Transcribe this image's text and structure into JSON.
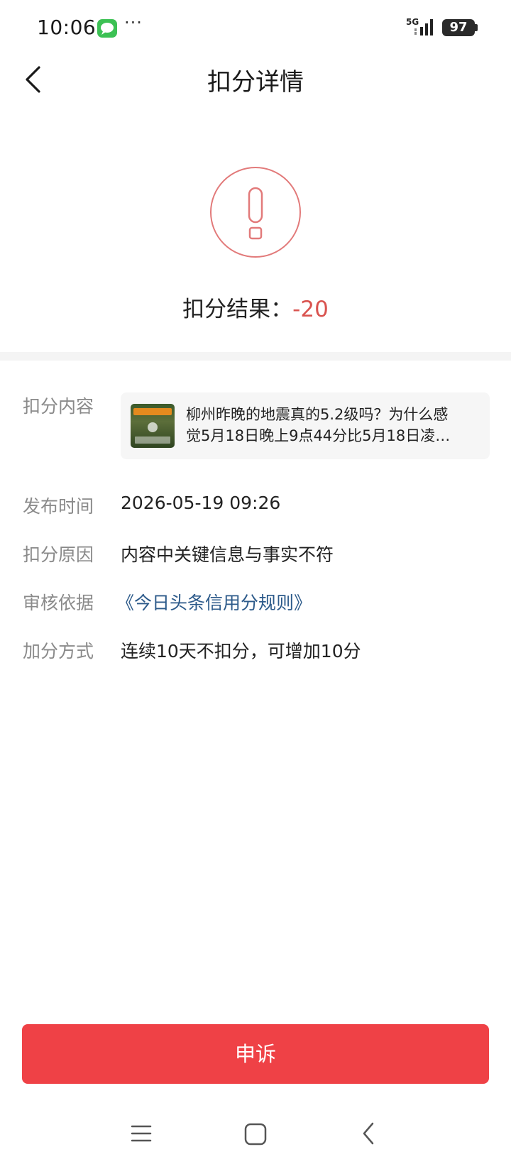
{
  "status_bar": {
    "time": "10:06",
    "network": "5G",
    "battery": "97",
    "more": "···",
    "icons": [
      "message-icon",
      "signal-icon",
      "battery-icon"
    ]
  },
  "nav": {
    "title": "扣分详情",
    "back_icon": "chevron-left-icon"
  },
  "result": {
    "icon": "exclamation-circle-icon",
    "label": "扣分结果：",
    "value": "-20",
    "value_color": "#d9534f"
  },
  "details": {
    "content_label": "扣分内容",
    "content_line1": "柳州昨晚的地震真的5.2级吗？为什么感",
    "content_line2": "觉5月18日晚上9点44分比5月18日凌…",
    "publish_time_label": "发布时间",
    "publish_time": "2026-05-19 09:26",
    "reason_label": "扣分原因",
    "reason": "内容中关键信息与事实不符",
    "basis_label": "审核依据",
    "basis": "《今日头条信用分规则》",
    "bonus_label": "加分方式",
    "bonus": "连续10天不扣分，可增加10分"
  },
  "actions": {
    "appeal": "申诉",
    "appeal_color": "#ef4146"
  },
  "system_nav": {
    "icons": [
      "menu-icon",
      "home-square-icon",
      "back-arrow-icon"
    ]
  }
}
